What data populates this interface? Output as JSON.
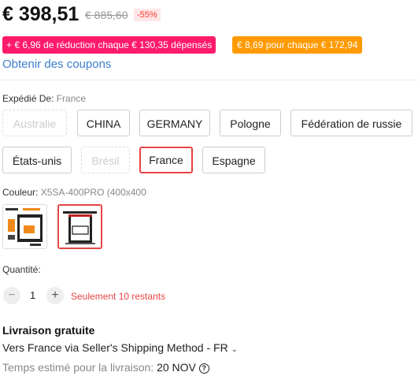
{
  "price": {
    "current": "€ 398,51",
    "original": "€ 885,60",
    "discount": "-55%"
  },
  "promotions": {
    "pink": "+ € 6,96 de réduction chaque € 130,35 dépensés",
    "orange": "€ 8,69 pour chaque € 172,94",
    "pink_color": "#ff1a6b",
    "orange_color": "#ff9a00"
  },
  "coupons_link": "Obtenir des coupons",
  "ship_from": {
    "label": "Expédié De:",
    "selected": "France",
    "options": [
      {
        "label": "Australie",
        "state": "disabled"
      },
      {
        "label": "CHINA",
        "state": "normal"
      },
      {
        "label": "GERMANY",
        "state": "normal"
      },
      {
        "label": "Pologne",
        "state": "normal"
      },
      {
        "label": "Fédération de russie",
        "state": "normal"
      },
      {
        "label": "États-unis",
        "state": "normal"
      },
      {
        "label": "Brésil",
        "state": "disabled"
      },
      {
        "label": "France",
        "state": "selected"
      },
      {
        "label": "Espagne",
        "state": "normal"
      }
    ]
  },
  "color": {
    "label": "Couleur:",
    "selected": "X5SA-400PRO (400x400",
    "thumbnails": [
      {
        "name": "printer-thumb-1",
        "state": "normal"
      },
      {
        "name": "printer-thumb-2",
        "state": "selected"
      }
    ]
  },
  "quantity": {
    "label": "Quantité:",
    "value": "1",
    "minus": "−",
    "plus": "+",
    "stock_note": "Seulement 10 restants"
  },
  "shipping": {
    "title": "Livraison gratuite",
    "method": "Vers France via Seller's Shipping Method - FR",
    "estimate_label": "Temps estimé pour la livraison:",
    "estimate_date": "20 NOV",
    "help_glyph": "?"
  },
  "colors": {
    "accent_red": "#e64545",
    "link_blue": "#3d7ecf"
  }
}
